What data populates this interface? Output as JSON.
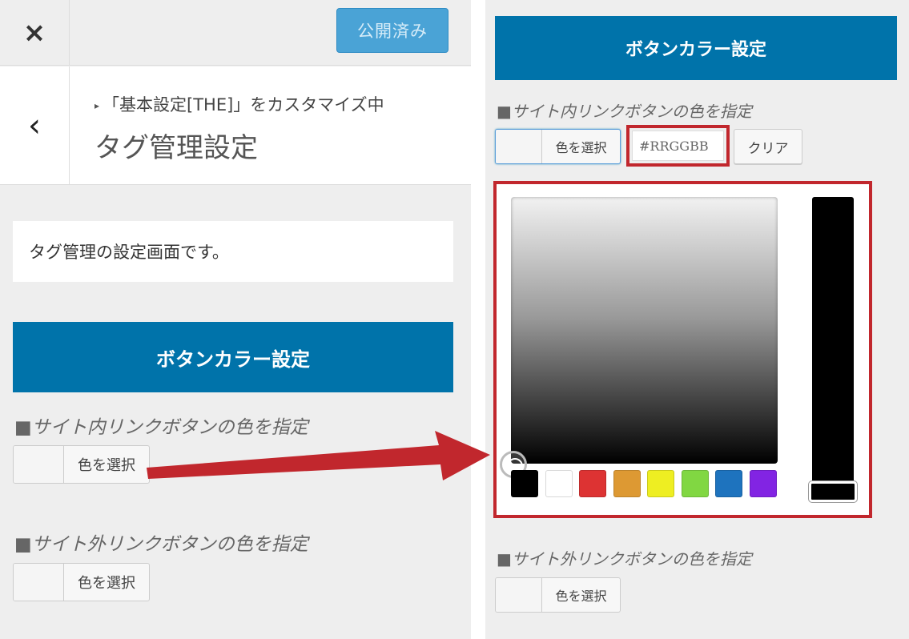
{
  "left": {
    "close_icon": "×",
    "publish_label": "公開済み",
    "back_icon": "‹",
    "customizing_marker": "▸",
    "customizing_label": "「基本設定[THE]」をカスタマイズ中",
    "section_title": "タグ管理設定",
    "description": "タグ管理の設定画面です。",
    "heading": "ボタンカラー設定",
    "internal_label": "■サイト内リンクボタンの色を指定",
    "internal_button": "色を選択",
    "external_label": "■サイト外リンクボタンの色を指定",
    "external_button": "色を選択"
  },
  "right": {
    "heading": "ボタンカラー設定",
    "internal_label": "■サイト内リンクボタンの色を指定",
    "internal_button": "色を選択",
    "hex_placeholder": "#RRGGBB",
    "clear_button": "クリア",
    "external_label": "■サイト外リンクボタンの色を指定",
    "external_button": "色を選択",
    "palette": [
      "#000000",
      "#ffffff",
      "#dd3333",
      "#dd9933",
      "#eeee22",
      "#81d742",
      "#1e73be",
      "#8224e3"
    ]
  },
  "colors": {
    "heading_bg": "#0073aa",
    "publish_bg": "#4aa3d6",
    "highlight_border": "#c1272d",
    "arrow": "#c1272d"
  }
}
